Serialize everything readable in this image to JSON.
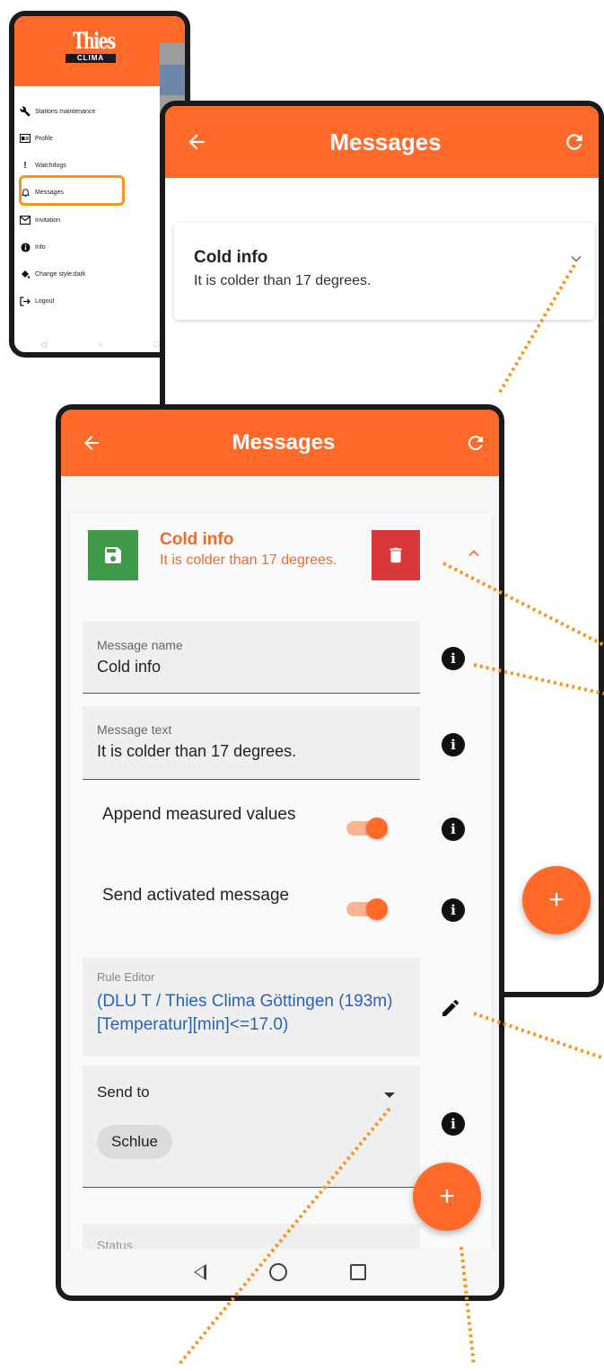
{
  "drawer": {
    "logo_top": "Thies",
    "logo_bottom": "CLIMA",
    "items": [
      {
        "label": "Stations maintenance",
        "icon": "wrench-icon"
      },
      {
        "label": "Profile",
        "icon": "id-card-icon"
      },
      {
        "label": "Watchdogs",
        "icon": "exclamation-icon"
      },
      {
        "label": "Messages",
        "icon": "bell-icon"
      },
      {
        "label": "Invitation",
        "icon": "envelope-icon"
      },
      {
        "label": "Info",
        "icon": "info-icon"
      },
      {
        "label": "Change style:dark",
        "icon": "paint-bucket-icon"
      },
      {
        "label": "Logout",
        "icon": "logout-icon"
      }
    ],
    "highlighted_item": "Messages",
    "highlight_color": "#f7941d"
  },
  "list_screen": {
    "title": "Messages",
    "message": {
      "title": "Cold info",
      "text": "It is colder than 17 degrees."
    },
    "fab_label": "+"
  },
  "detail_screen": {
    "title": "Messages",
    "header": {
      "title": "Cold info",
      "text": "It is colder than 17 degrees."
    },
    "fields": {
      "name_label": "Message name",
      "name_value": "Cold info",
      "text_label": "Message text",
      "text_value": "It is colder than 17 degrees."
    },
    "toggles": [
      {
        "label": "Append measured values",
        "on": true
      },
      {
        "label": "Send activated message",
        "on": true
      }
    ],
    "rule_editor": {
      "label": "Rule Editor",
      "rule": "(DLU T / Thies Clima Göttingen (193m)[Temperatur][min]<=17.0)"
    },
    "send_to": {
      "label": "Send to",
      "recipients": [
        "Schlue"
      ]
    },
    "status_label": "Status",
    "fab_label": "+"
  },
  "colors": {
    "accent": "#ff6a2b",
    "save": "#3e9a48",
    "delete": "#d9383a",
    "rule_text": "#2a62b8",
    "callout": "#f7941d"
  }
}
